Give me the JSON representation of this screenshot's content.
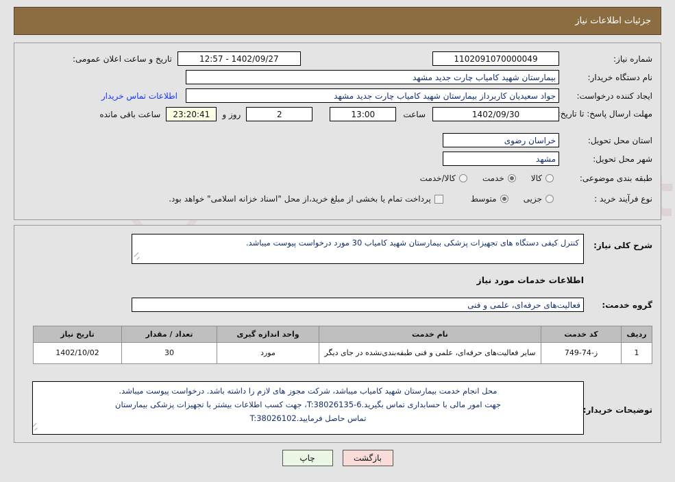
{
  "header": {
    "title": "جزئیات اطلاعات نیاز"
  },
  "form": {
    "need_number_label": "شماره نیاز:",
    "need_number_value": "1102091070000049",
    "announce_label": "تاریخ و ساعت اعلان عمومی:",
    "announce_value": "1402/09/27 - 12:57",
    "buyer_org_label": "نام دستگاه خریدار:",
    "buyer_org_value": "بیمارستان شهید کامیاب چارت جدید مشهد",
    "creator_label": "ایجاد کننده درخواست:",
    "creator_value": "جواد سعیدیان کاربرداز بیمارستان شهید کامیاب چارت جدید مشهد",
    "contact_link": "اطلاعات تماس خریدار",
    "deadline_label": "مهلت ارسال پاسخ: تا تاریخ:",
    "deadline_date": "1402/09/30",
    "hour_label": "ساعت",
    "deadline_time": "13:00",
    "days_value": "2",
    "days_label": "روز و",
    "countdown_value": "23:20:41",
    "countdown_label": "ساعت باقی مانده",
    "province_label": "استان محل تحویل:",
    "province_value": "خراسان رضوی",
    "city_label": "شهر محل تحویل:",
    "city_value": "مشهد",
    "category_label": "طبقه بندی موضوعی:",
    "category_options": [
      "کالا",
      "خدمت",
      "کالا/خدمت"
    ],
    "category_selected": "خدمت",
    "process_label": "نوع فرآیند خرید :",
    "process_options": [
      "جزیی",
      "متوسط"
    ],
    "process_selected": "متوسط",
    "treasury_note": "پرداخت تمام یا بخشی از مبلغ خرید،از محل \"اسناد خزانه اسلامی\" خواهد بود."
  },
  "description": {
    "label": "شرح کلی نیاز:",
    "value": "کنترل کیفی دستگاه های تجهیزات پزشکی بیمارستان شهید کامیاب 30 مورد درخواست پیوست میباشد."
  },
  "services_section": {
    "heading": "اطلاعات خدمات مورد نیاز",
    "group_label": "گروه خدمت:",
    "group_value": "فعالیت‌های حرفه‌ای، علمی و فنی"
  },
  "table": {
    "columns": [
      "ردیف",
      "کد خدمت",
      "نام خدمت",
      "واحد اندازه گیری",
      "تعداد / مقدار",
      "تاریخ نیاز"
    ],
    "rows": [
      {
        "radif": "1",
        "code": "ز-74-749",
        "name": "سایر فعالیت‌های حرفه‌ای، علمی و فنی طبقه‌بندی‌نشده در جای دیگر",
        "unit": "مورد",
        "qty": "30",
        "date": "1402/10/02"
      }
    ]
  },
  "buyer_notes": {
    "label": "توضیحات خریدار:",
    "line1": "محل انجام خدمت بیمارستان شهید کامیاب میباشد، شرکت مجوز های لازم را داشته باشد. درخواست پیوست میباشد.",
    "line2": "جهت امور مالی با حسابداری تماس بگیرید.T:38026135-6، جهت کسب اطلاعات بیشتر با تجهیزات پزشکی بیمارستان",
    "line3": "تماس حاصل فرمایید.T:38026102"
  },
  "buttons": {
    "print": "چاپ",
    "back": "بازگشت"
  },
  "colors": {
    "header_bg": "#8c6d42",
    "page_bg": "#e4e4e4",
    "link": "#1a35ff",
    "table_header": "#bfbfbf",
    "timer_bg": "#ffffe6",
    "print_btn": "#e9f7e4",
    "back_btn": "#fadcd9"
  },
  "watermark": {
    "text": "AriaTender.net"
  }
}
